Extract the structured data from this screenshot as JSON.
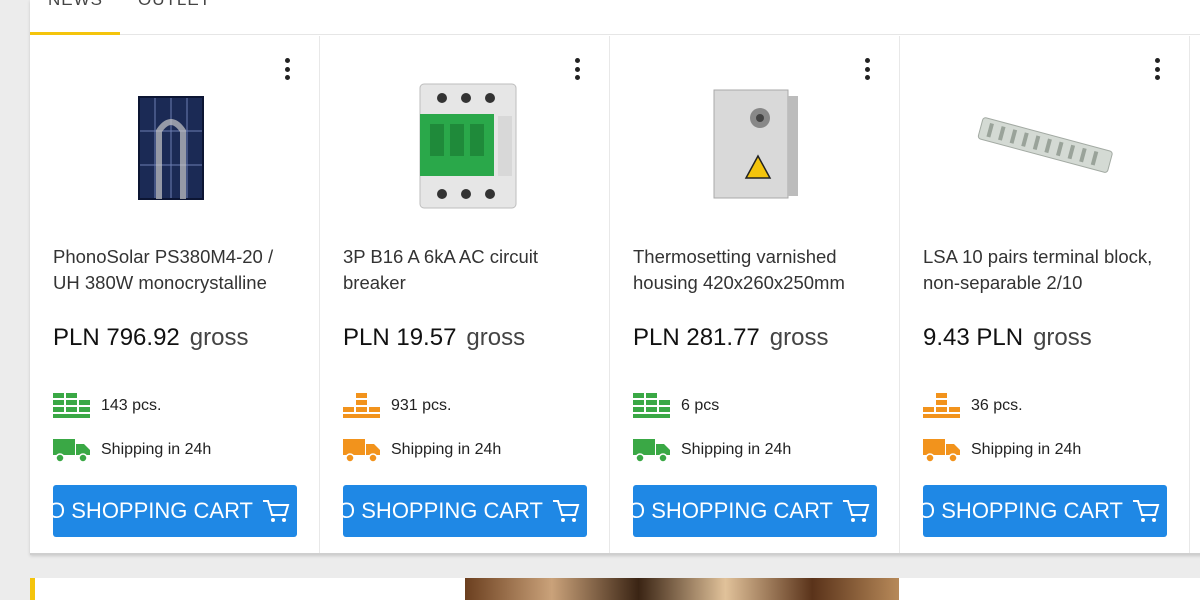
{
  "tabs": [
    {
      "label": "NEWS",
      "active": true
    },
    {
      "label": "OUTLET",
      "active": false
    }
  ],
  "colors": {
    "accent": "#f4c40c",
    "button": "#1f88e5",
    "stock_high": "#3aa845",
    "stock_low": "#f2931c",
    "shipping_green": "#3aa845",
    "shipping_orange": "#f2931c"
  },
  "products": [
    {
      "title": "PhonoSolar PS380M4-20 / UH 380W monocrystalline",
      "price": "PLN 796.92",
      "price_suffix": "gross",
      "stock": "143 pcs.",
      "stock_level": "high",
      "shipping": "Shipping in 24h",
      "image_icon": "solar-panel",
      "cart_label": "ADD TO SHOPPING CART"
    },
    {
      "title": "3P B16 A 6kA AC circuit breaker",
      "price": "PLN 19.57",
      "price_suffix": "gross",
      "stock": "931 pcs.",
      "stock_level": "low",
      "shipping": "Shipping in 24h",
      "image_icon": "circuit-breaker",
      "cart_label": "ADD TO SHOPPING CART"
    },
    {
      "title": "Thermosetting varnished housing 420x260x250mm",
      "price": "PLN 281.77",
      "price_suffix": "gross",
      "stock": "6 pcs",
      "stock_level": "high",
      "shipping": "Shipping in 24h",
      "image_icon": "electrical-housing",
      "cart_label": "ADD TO SHOPPING CART"
    },
    {
      "title": "LSA 10 pairs terminal block, non-separable 2/10",
      "price": "9.43 PLN",
      "price_suffix": "gross",
      "stock": "36 pcs.",
      "stock_level": "low",
      "shipping": "Shipping in 24h",
      "image_icon": "terminal-block",
      "cart_label": "ADD TO SHOPPING CART"
    }
  ]
}
